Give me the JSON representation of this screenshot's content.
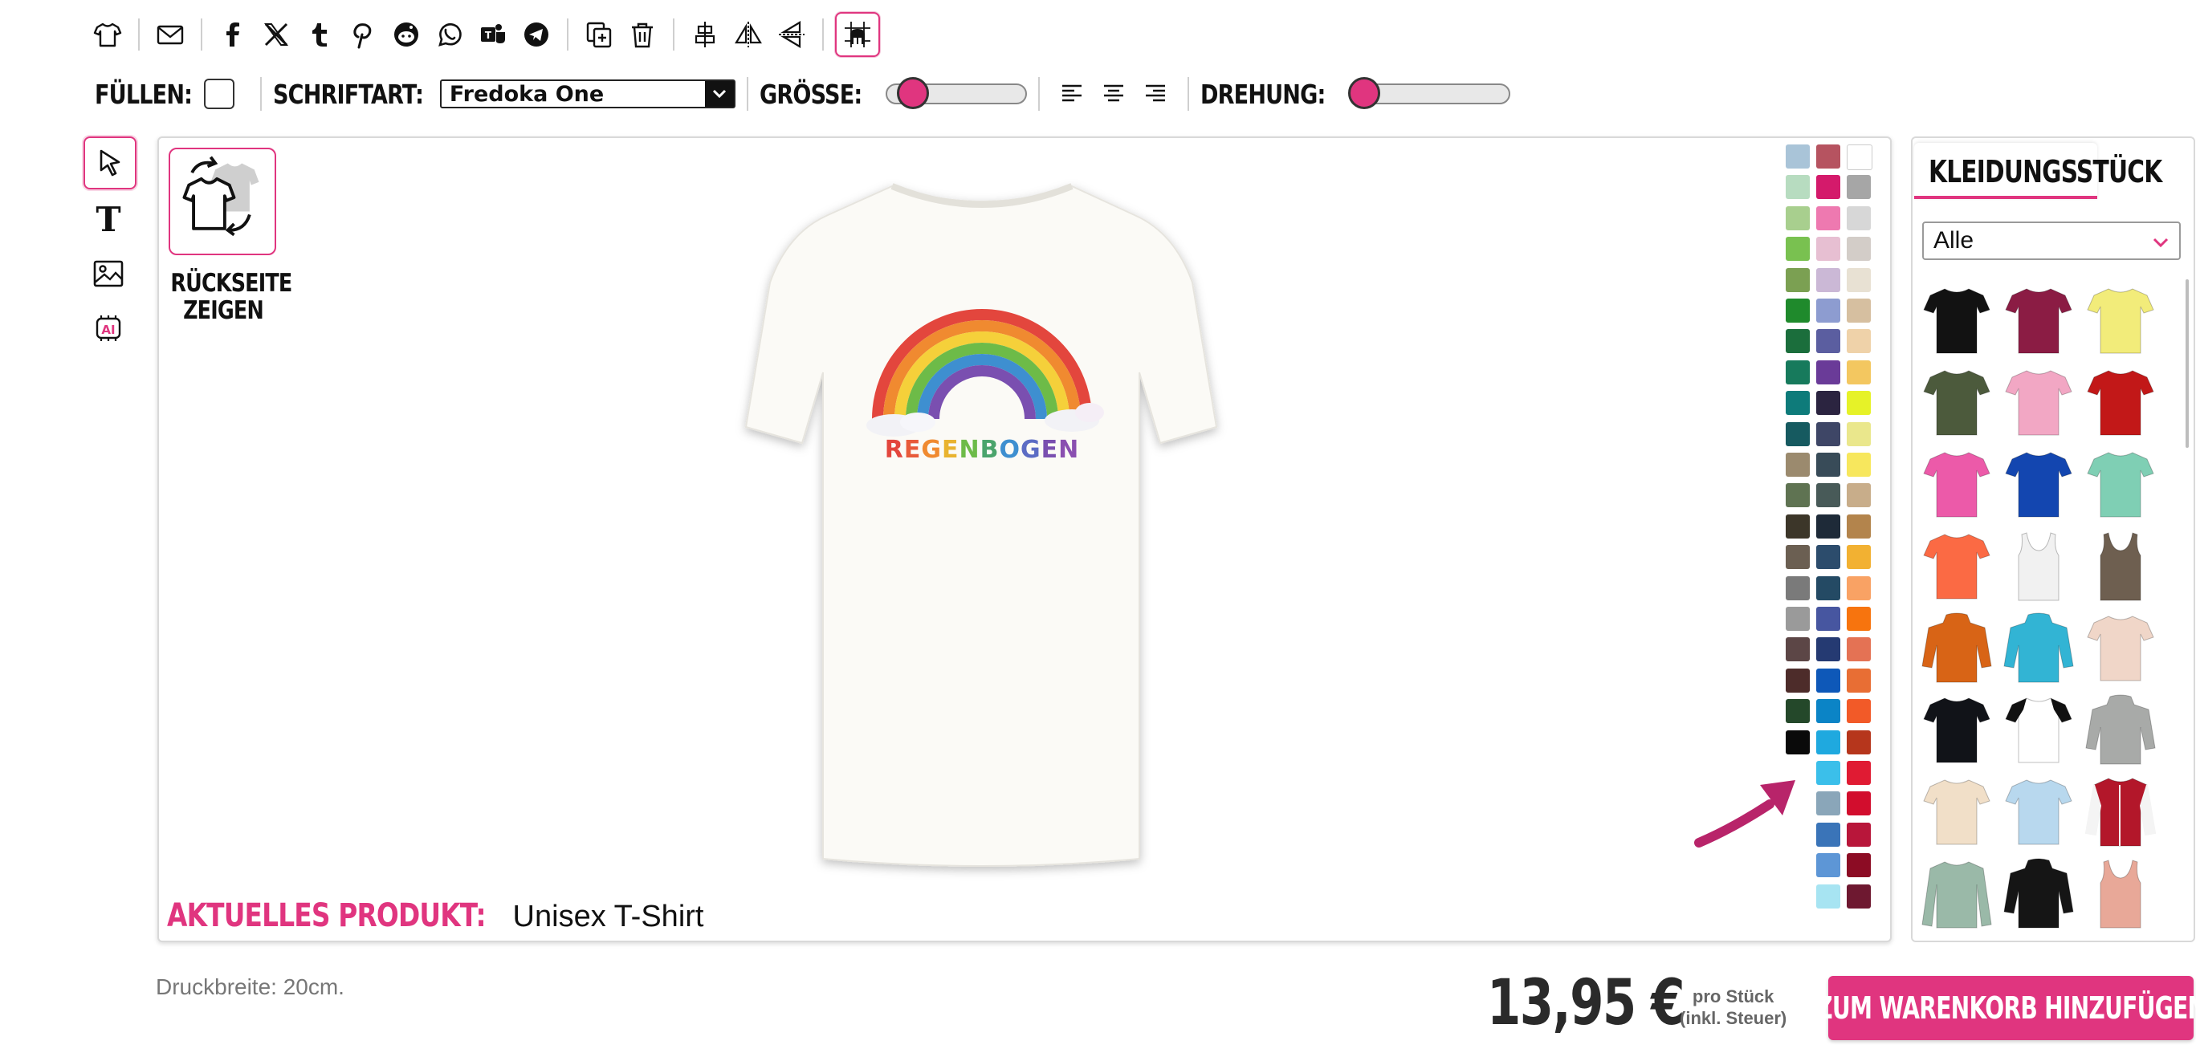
{
  "toolbar": {
    "buttons": [
      {
        "name": "tshirt-icon"
      },
      {
        "name": "mail-icon"
      },
      {
        "name": "facebook-icon"
      },
      {
        "name": "x-icon"
      },
      {
        "name": "tumblr-icon"
      },
      {
        "name": "pinterest-icon"
      },
      {
        "name": "reddit-icon"
      },
      {
        "name": "whatsapp-icon"
      },
      {
        "name": "teams-icon"
      },
      {
        "name": "telegram-icon"
      },
      {
        "name": "duplicate-icon"
      },
      {
        "name": "trash-icon"
      },
      {
        "name": "align-center-icon"
      },
      {
        "name": "flip-horizontal-icon"
      },
      {
        "name": "flip-vertical-icon"
      },
      {
        "name": "grid-snap-icon"
      }
    ]
  },
  "format_bar": {
    "fill_label": "FÜLLEN:",
    "font_label": "SCHRIFTART:",
    "font_value": "Fredoka One",
    "size_label": "GRÖSSE:",
    "rotation_label": "DREHUNG:"
  },
  "tools": [
    {
      "name": "select-pointer-icon"
    },
    {
      "name": "text-icon"
    },
    {
      "name": "image-icon"
    },
    {
      "name": "ai-icon"
    }
  ],
  "canvas": {
    "back_label": "RÜCKSEITE ZEIGEN",
    "design_text": "REGENBOGEN",
    "product_key": "AKTUELLES PRODUKT:",
    "product_value": "Unisex T-Shirt"
  },
  "palette": {
    "col1": [
      "#a9c4d8",
      "#b7dcc0",
      "#a8cf8e",
      "#79c150",
      "#7ba052",
      "#1f8a2c",
      "#1b6e3c",
      "#177a5c",
      "#0e7b7a",
      "#165a60",
      "#9b8a6e",
      "#5f7352",
      "#3c3629",
      "#6b5f52",
      "#7a7a7a",
      "#9a9a9a",
      "#5c4646",
      "#4d2c2a",
      "#24482a",
      "#0a0a0a"
    ],
    "col2": [
      "#b65360",
      "#d41a6b",
      "#ee79b0",
      "#e7bfd2",
      "#cbb8d6",
      "#8d9cd0",
      "#5b5ea0",
      "#6a3b98",
      "#2b2440",
      "#3e4666",
      "#384b58",
      "#485a58",
      "#1e2a38",
      "#2c4c6c",
      "#244a64",
      "#4756a0",
      "#253a72",
      "#0e58b8",
      "#0b84c6",
      "#1fa9df",
      "#3bbfea",
      "#8aa6b9",
      "#3a74b8",
      "#5d96d6",
      "#a7e4f2"
    ],
    "col3": [
      "#ffffff",
      "#a6a6a6",
      "#d7d7d7",
      "#d3cdc8",
      "#e8e1d3",
      "#d6bfa0",
      "#efd2a9",
      "#f3c760",
      "#e6f228",
      "#eae78c",
      "#f7e75d",
      "#c8ad8a",
      "#b3844c",
      "#f2b132",
      "#f9a264",
      "#f7740e",
      "#e47254",
      "#e86e34",
      "#f25a28",
      "#b6361c",
      "#e01b33",
      "#d20d2d",
      "#b8163a",
      "#8c0c24",
      "#6e1830"
    ]
  },
  "garments_panel": {
    "title": "KLEIDUNGSSTÜCK",
    "filter_value": "Alle",
    "items": [
      {
        "type": "tee",
        "color": "#121212"
      },
      {
        "type": "tee",
        "color": "#8b1c44"
      },
      {
        "type": "tee",
        "color": "#f2ec7a"
      },
      {
        "type": "tee",
        "color": "#4c5a3c"
      },
      {
        "type": "tee",
        "color": "#f2a7c4"
      },
      {
        "type": "tee",
        "color": "#c21818"
      },
      {
        "type": "tee",
        "color": "#ec5aa9"
      },
      {
        "type": "tee",
        "color": "#1346b0"
      },
      {
        "type": "tee",
        "color": "#7fcfb4"
      },
      {
        "type": "tee",
        "color": "#fb6a44"
      },
      {
        "type": "tank",
        "color": "#f1f1f1"
      },
      {
        "type": "tank",
        "color": "#6e5f50"
      },
      {
        "type": "hoodie",
        "color": "#d86416"
      },
      {
        "type": "hoodie",
        "color": "#32b4d4"
      },
      {
        "type": "tee",
        "color": "#f0d6c8"
      },
      {
        "type": "tee",
        "color": "#111318"
      },
      {
        "type": "raglan",
        "color": "#ffffff"
      },
      {
        "type": "hoodie",
        "color": "#a8aaa8"
      },
      {
        "type": "tee",
        "color": "#f1dfc8"
      },
      {
        "type": "tee",
        "color": "#b8d8ee"
      },
      {
        "type": "jacket",
        "color": "#b3172a"
      },
      {
        "type": "longsleeve",
        "color": "#9ab9a8"
      },
      {
        "type": "hoodie",
        "color": "#151515"
      },
      {
        "type": "tank",
        "color": "#e8a898"
      }
    ]
  },
  "footer": {
    "print_width": "Druckbreite: 20cm.",
    "price": "13,95 €",
    "per_piece_1": "pro Stück",
    "per_piece_2": "(inkl. Steuer)",
    "cart_label": "ZUM WARENKORB HINZUFÜGEN"
  },
  "colors": {
    "accent": "#e0357f"
  }
}
